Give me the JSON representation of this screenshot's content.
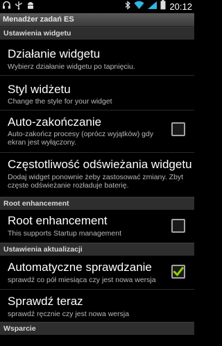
{
  "status_bar": {
    "time": "20:12",
    "left_icons": [
      "headset-icon",
      "usb-icon",
      "android-debug-icon"
    ],
    "right_icons": [
      "bluetooth-icon",
      "wifi-icon",
      "signal-icon",
      "battery-icon"
    ]
  },
  "app": {
    "title": "Menadżer zadań ES"
  },
  "sections": [
    {
      "header": "Ustawienia widgetu"
    },
    {
      "header": "Root enhancement"
    },
    {
      "header": "Ustawienia aktualizacji"
    },
    {
      "header": "Wsparcie"
    }
  ],
  "items": [
    {
      "title": "Działanie widgetu",
      "summary": "Wybierz działanie widgetu po tapnięciu."
    },
    {
      "title": "Styl widżetu",
      "summary": "Change the style for your widget"
    },
    {
      "title": "Auto-zakończanie",
      "summary": "Auto-zakończ procesy (oprócz wyjątków) gdy ekran jest wyłączony.",
      "checked": false
    },
    {
      "title": "Częstotliwość odświeżania widgetu",
      "summary": "Dodaj widget ponownie żeby zastosować zmiany. Zbyt częste odświeżanie rozładuje baterię."
    },
    {
      "title": "Root enhancement",
      "summary": "This supports Startup management",
      "checked": false
    },
    {
      "title": "Automatyczne sprawdzanie",
      "summary": "sprawdź co pół miesiąca czy jest nowa wersja",
      "checked": true
    },
    {
      "title": "Sprawdź teraz",
      "summary": "sprawdź ręcznie czy jest nowa wersja"
    }
  ],
  "colors": {
    "check_green": "#8fd400",
    "section_bg": "#2e2e2e",
    "background": "#000000"
  }
}
